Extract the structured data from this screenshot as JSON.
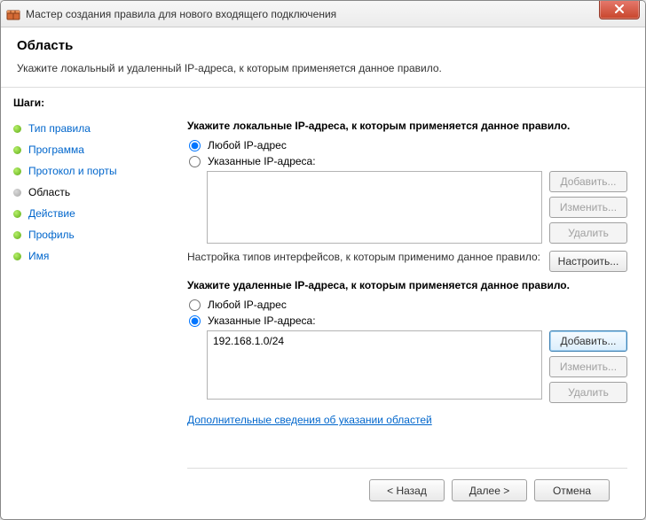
{
  "title": "Мастер создания правила для нового входящего подключения",
  "header": {
    "heading": "Область",
    "subheading": "Укажите локальный и удаленный IP-адреса, к которым применяется данное правило."
  },
  "sidebar": {
    "title": "Шаги:",
    "steps": [
      {
        "label": "Тип правила",
        "current": false
      },
      {
        "label": "Программа",
        "current": false
      },
      {
        "label": "Протокол и порты",
        "current": false
      },
      {
        "label": "Область",
        "current": true
      },
      {
        "label": "Действие",
        "current": false
      },
      {
        "label": "Профиль",
        "current": false
      },
      {
        "label": "Имя",
        "current": false
      }
    ]
  },
  "main": {
    "local": {
      "heading": "Укажите локальные IP-адреса, к которым применяется данное правило.",
      "any_label": "Любой IP-адрес",
      "specified_label": "Указанные IP-адреса:",
      "selected": "any",
      "items": [],
      "buttons": {
        "add": "Добавить...",
        "edit": "Изменить...",
        "remove": "Удалить"
      }
    },
    "interfaces": {
      "text": "Настройка типов интерфейсов, к которым применимо данное правило:",
      "button": "Настроить..."
    },
    "remote": {
      "heading": "Укажите удаленные IP-адреса, к которым применяется данное правило.",
      "any_label": "Любой IP-адрес",
      "specified_label": "Указанные IP-адреса:",
      "selected": "specified",
      "items": [
        "192.168.1.0/24"
      ],
      "buttons": {
        "add": "Добавить...",
        "edit": "Изменить...",
        "remove": "Удалить"
      }
    },
    "link": "Дополнительные сведения об указании областей"
  },
  "footer": {
    "back": "< Назад",
    "next": "Далее >",
    "cancel": "Отмена"
  }
}
